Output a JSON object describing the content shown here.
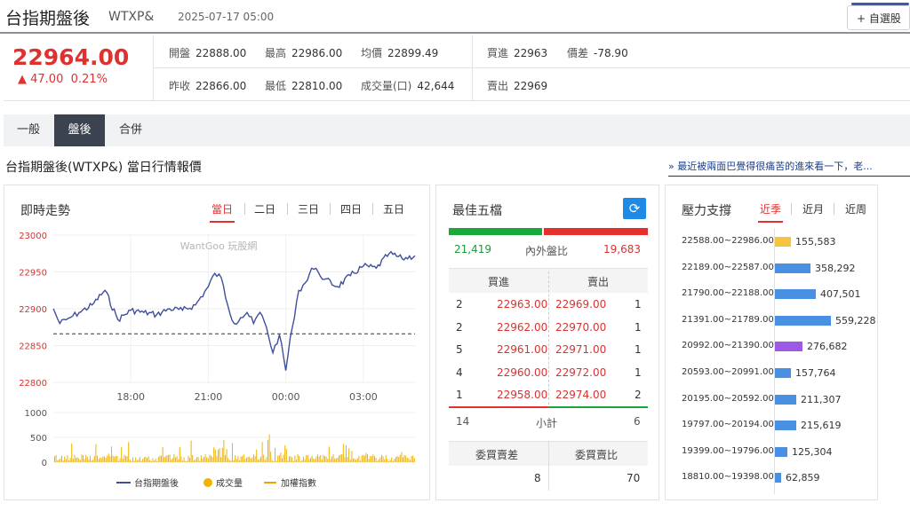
{
  "header": {
    "title": "台指期盤後",
    "code": "WTXP&",
    "datetime": "2025-07-17 05:00",
    "watch_label": "+ 自選股"
  },
  "quote": {
    "price": "22964.00",
    "change": "▲ 47.00",
    "change_pct": "0.21%",
    "open_label": "開盤",
    "open": "22888.00",
    "high_label": "最高",
    "high": "22986.00",
    "avg_label": "均價",
    "avg": "22899.49",
    "bid_label": "買進",
    "bid": "22963",
    "spread_label": "價差",
    "spread": "-78.90",
    "prev_label": "昨收",
    "prev": "22866.00",
    "low_label": "最低",
    "low": "22810.00",
    "vol_label": "成交量(口)",
    "vol": "42,644",
    "ask_label": "賣出",
    "ask": "22969"
  },
  "tabs": [
    "一般",
    "盤後",
    "合併"
  ],
  "section_title": "台指期盤後(WTXP&) 當日行情報價",
  "news_link": "» 最近被兩面巴覺得很痛苦的進來看一下，老...",
  "trend": {
    "title": "即時走勢",
    "ranges": [
      "當日",
      "二日",
      "三日",
      "四日",
      "五日"
    ],
    "watermark": "WantGoo 玩股網",
    "legend": [
      "台指期盤後",
      "成交量",
      "加權指數"
    ]
  },
  "chart_data": {
    "type": "line",
    "title": "即時走勢",
    "x_ticks": [
      "18:00",
      "21:00",
      "00:00",
      "03:00"
    ],
    "y_ticks": [
      "23000",
      "22950",
      "22900",
      "22850",
      "22800"
    ],
    "ylim": [
      22800,
      23000
    ],
    "reference_line": 22866,
    "volume_ticks": [
      "1000",
      "500",
      "0"
    ],
    "series": [
      {
        "name": "台指期盤後",
        "color": "#3e4f9c",
        "x": [
          "15:00",
          "15:15",
          "15:30",
          "15:45",
          "16:00",
          "16:30",
          "17:00",
          "17:30",
          "18:00",
          "18:30",
          "19:00",
          "19:30",
          "20:00",
          "20:30",
          "21:00",
          "21:15",
          "21:30",
          "21:45",
          "22:00",
          "22:15",
          "22:30",
          "22:45",
          "23:00",
          "23:15",
          "23:30",
          "23:45",
          "00:00",
          "00:10",
          "00:20",
          "00:30",
          "00:45",
          "01:00",
          "01:15",
          "01:30",
          "02:00",
          "02:30",
          "03:00",
          "03:30",
          "04:00",
          "04:30",
          "05:00"
        ],
        "y": [
          22900,
          22880,
          22885,
          22890,
          22895,
          22905,
          22925,
          22885,
          22898,
          22895,
          22892,
          22900,
          22898,
          22905,
          22930,
          22948,
          22942,
          22905,
          22880,
          22888,
          22895,
          22880,
          22895,
          22875,
          22840,
          22865,
          22816,
          22860,
          22888,
          22925,
          22935,
          22955,
          22950,
          22940,
          22930,
          22945,
          22958,
          22955,
          22975,
          22968,
          22972
        ]
      },
      {
        "name": "成交量",
        "color": "#f0b400"
      },
      {
        "name": "加權指數",
        "color": "#f0a000"
      }
    ]
  },
  "orderbook": {
    "title": "最佳五檔",
    "outer": "21,419",
    "ratio_label": "內外盤比",
    "inner": "19,683",
    "outer_share": 0.47,
    "bid_header": "買進",
    "ask_header": "賣出",
    "rows": [
      {
        "bq": "2",
        "bp": "22963.00",
        "ap": "22969.00",
        "aq": "1"
      },
      {
        "bq": "2",
        "bp": "22962.00",
        "ap": "22970.00",
        "aq": "1"
      },
      {
        "bq": "5",
        "bp": "22961.00",
        "ap": "22971.00",
        "aq": "1"
      },
      {
        "bq": "4",
        "bp": "22960.00",
        "ap": "22972.00",
        "aq": "1"
      },
      {
        "bq": "1",
        "bp": "22958.00",
        "ap": "22974.00",
        "aq": "2"
      }
    ],
    "sub_label": "小計",
    "sub_bid": "14",
    "sub_ask": "6",
    "diff_label": "委買賣差",
    "diff": "8",
    "ratio2_label": "委買賣比",
    "ratio2": "70"
  },
  "pressure": {
    "title": "壓力支撐",
    "tabs": [
      "近季",
      "近月",
      "近周"
    ],
    "rows": [
      {
        "range": "22588.00~22986.00",
        "value": 155583,
        "label": "155,583",
        "color": "#f6c343"
      },
      {
        "range": "22189.00~22587.00",
        "value": 358292,
        "label": "358,292",
        "color": "#4a90e2"
      },
      {
        "range": "21790.00~22188.00",
        "value": 407501,
        "label": "407,501",
        "color": "#4a90e2"
      },
      {
        "range": "21391.00~21789.00",
        "value": 559228,
        "label": "559,228",
        "color": "#4a90e2"
      },
      {
        "range": "20992.00~21390.00",
        "value": 276682,
        "label": "276,682",
        "color": "#9b59e6"
      },
      {
        "range": "20593.00~20991.00",
        "value": 157764,
        "label": "157,764",
        "color": "#4a90e2"
      },
      {
        "range": "20195.00~20592.00",
        "value": 211307,
        "label": "211,307",
        "color": "#4a90e2"
      },
      {
        "range": "19797.00~20194.00",
        "value": 215619,
        "label": "215,619",
        "color": "#4a90e2"
      },
      {
        "range": "19399.00~19796.00",
        "value": 125304,
        "label": "125,304",
        "color": "#4a90e2"
      },
      {
        "range": "18810.00~19398.00",
        "value": 62859,
        "label": "62,859",
        "color": "#4a90e2"
      }
    ]
  }
}
